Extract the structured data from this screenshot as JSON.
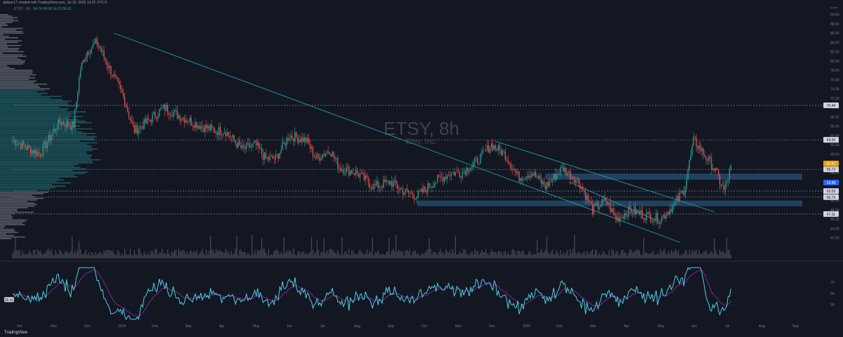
{
  "header": {
    "caption": "daltzer17 created with TradingView.com, Jul 10, 2025 13:22 UTC-5",
    "legend_label": "ETSY · 8h ·",
    "legend_values": "54.74  58.06  54.15  58.01"
  },
  "footer": {
    "brand": "TradingView"
  },
  "watermark": {
    "ticker": "ETSY, 8h",
    "company": "Etsy, Inc."
  },
  "colors": {
    "background": "#131722",
    "up": "#26a69a",
    "down": "#ef5350",
    "trendline": "#1e9cb0",
    "zone": "#2a5f8a",
    "oscillator": "#4dd0e1",
    "oscillator_signal": "#9c27b0",
    "volume_profile": "#6f7480",
    "volume_profile_va": "#1d6e72"
  },
  "chart_data": {
    "type": "candlestick",
    "symbol": "ETSY",
    "timeframe": "8h",
    "title": "ETSY, 8h",
    "subtitle": "Etsy, Inc.",
    "price_axis": {
      "ylim": [
        40,
        91
      ],
      "ticks": [
        90,
        88,
        86,
        84,
        82,
        80,
        78,
        76,
        74,
        72,
        70,
        68,
        66,
        64,
        62,
        60,
        58,
        56,
        54,
        52,
        50,
        48,
        46,
        44,
        42
      ],
      "unit": "USD"
    },
    "time_axis": {
      "labels": [
        "Oct",
        "Nov",
        "Dec",
        "2024",
        "Feb",
        "Mar",
        "Apr",
        "May",
        "Jun",
        "Jul",
        "Aug",
        "Sep",
        "Oct",
        "Nov",
        "Dec",
        "2025",
        "Feb",
        "Mar",
        "Apr",
        "May",
        "Jun",
        "Jul",
        "Aug",
        "Sep"
      ]
    },
    "price_path": {
      "x_months": [
        0,
        0.8,
        1.4,
        1.8,
        2.0,
        2.2,
        2.5,
        2.9,
        3.3,
        3.6,
        4.0,
        4.5,
        5.0,
        5.6,
        6.0,
        6.3,
        6.8,
        7.2,
        7.5,
        7.8,
        8.2,
        8.7,
        9.0,
        9.4,
        9.7,
        10.2,
        10.7,
        11.2,
        11.6,
        12.0,
        12.5,
        13.0,
        13.3,
        13.7,
        14.2,
        14.6,
        15.0,
        15.4,
        15.8,
        16.3,
        16.8,
        17.2,
        17.6,
        17.9,
        18.3,
        18.7,
        19.2,
        19.6,
        19.9,
        20.2,
        20.5,
        20.8,
        21.1,
        21.3
      ],
      "close": [
        63,
        60,
        67,
        66,
        78,
        82,
        84,
        78,
        72,
        65,
        67,
        70,
        68,
        66,
        65,
        65,
        61,
        62,
        59,
        59,
        64,
        63,
        59,
        61,
        57,
        56,
        53,
        54,
        52,
        51,
        54,
        56,
        56,
        58,
        62,
        60,
        55,
        56,
        53,
        57,
        54,
        48,
        50,
        46,
        48,
        47,
        46,
        49,
        52,
        63,
        60,
        57,
        52,
        57
      ]
    },
    "price_axis_labels": [
      {
        "value": 70.48,
        "label": "70.48"
      },
      {
        "value": 63.06,
        "label": "63.06"
      },
      {
        "value": 57.97,
        "label": "57.97"
      },
      {
        "value": 56.72,
        "label": "56.72"
      },
      {
        "value": 53.88,
        "label": "53.88"
      },
      {
        "value": 52.05,
        "label": "52.05"
      },
      {
        "value": 50.75,
        "label": "50.75"
      },
      {
        "value": 47.11,
        "label": "47.11"
      }
    ],
    "horizontal_levels": [
      70.48,
      63.06,
      56.72,
      52.05,
      50.75,
      47.11
    ],
    "supply_demand_zones": [
      {
        "from": 54.5,
        "to": 55.8,
        "start_month": 15.8
      },
      {
        "from": 48.8,
        "to": 50.0,
        "start_month": 12.0
      }
    ],
    "trendlines": [
      {
        "start": [
          3.0,
          86
        ],
        "end": [
          19.8,
          41
        ]
      },
      {
        "start": [
          14.3,
          62.8
        ],
        "end": [
          20.8,
          47.6
        ]
      },
      {
        "start": [
          16.5,
          54
        ],
        "end": [
          19.1,
          45.7
        ]
      }
    ],
    "oscillator": {
      "axis_ticks": [
        70,
        50,
        30
      ],
      "axis_labels": [
        {
          "value": 38.43,
          "label": "38.43"
        }
      ]
    },
    "legend": "none"
  }
}
